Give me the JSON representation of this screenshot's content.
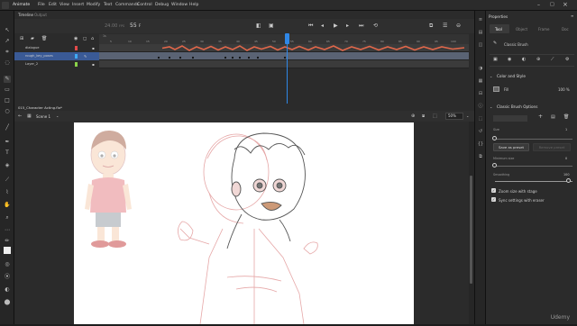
{
  "app": {
    "name": "Animate",
    "icon": "an-logo-icon"
  },
  "menu": [
    "File",
    "Edit",
    "View",
    "Insert",
    "Modify",
    "Text",
    "Commands",
    "Control",
    "Debug",
    "Window",
    "Help"
  ],
  "timeline": {
    "tabs": [
      "Timeline",
      "Output"
    ],
    "fps": "24.00",
    "fps_unit": "FPS",
    "frame": "55",
    "frame_unit": "F",
    "ruler_numbers": [
      "1s",
      "5",
      "10",
      "15",
      "20",
      "25",
      "30",
      "35",
      "40",
      "45",
      "50",
      "55",
      "60",
      "65",
      "70",
      "75",
      "80",
      "85",
      "90",
      "95",
      "100"
    ],
    "layers": [
      {
        "name": "dialogue",
        "color": "#e24a4a",
        "selected": false
      },
      {
        "name": "rough_key_poses",
        "color": "#3fa9f5",
        "selected": true
      },
      {
        "name": "Layer_2",
        "color": "#8ad24a",
        "selected": false
      }
    ]
  },
  "stage": {
    "doc_tab": "015_Character Acting.fla*",
    "scene": "Scene 1",
    "zoom": "50%"
  },
  "properties": {
    "title": "Properties",
    "tabs": [
      "Tool",
      "Object",
      "Frame",
      "Doc"
    ],
    "tool_name": "Classic Brush",
    "color_section": "Color and Style",
    "fill_label": "Fill",
    "fill_percent": "100 %",
    "brush_section": "Classic Brush Options",
    "size_label": "Size",
    "size_value": "1",
    "save_preset": "Save as preset",
    "remove_preset": "Remove preset",
    "min_size_label": "Minimum size",
    "min_size_value": "0",
    "smoothing_label": "Smoothing",
    "smoothing_value": "100",
    "zoom_size_label": "Zoom size with stage",
    "sync_label": "Sync settings with eraser"
  },
  "watermark": "Udemy",
  "colors": {
    "accent": "#2f87e6",
    "selected_layer": "#3a5a96",
    "waveform": "#e0674a"
  }
}
